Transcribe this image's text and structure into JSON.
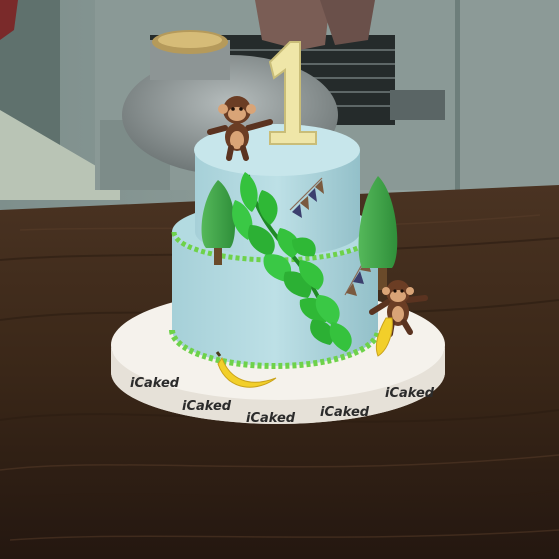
{
  "scene": {
    "board_brand": "iCaked",
    "topper_number": "1",
    "colors": {
      "fondant": "#a9d3dc",
      "board": "#f1ede6",
      "table": "#3a2618",
      "leaf": "#2fbf3a",
      "banana": "#f2cf2a",
      "topper": "#efe6a8"
    }
  }
}
